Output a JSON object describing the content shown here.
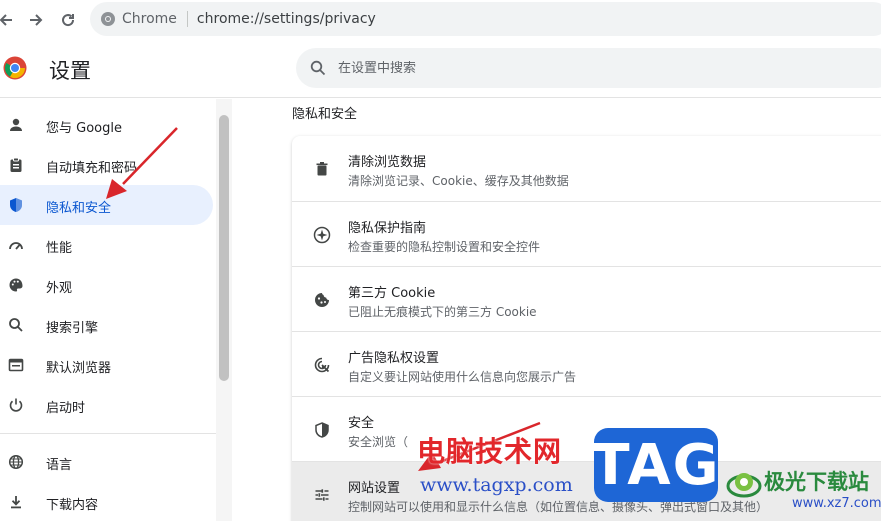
{
  "browser": {
    "site_name": "Chrome",
    "url": "chrome://settings/privacy"
  },
  "header": {
    "title": "设置",
    "search_placeholder": "在设置中搜索"
  },
  "sidebar": {
    "items": [
      {
        "label": "您与 Google",
        "icon": "person-icon"
      },
      {
        "label": "自动填充和密码",
        "icon": "clipboard-icon"
      },
      {
        "label": "隐私和安全",
        "icon": "shield-icon",
        "active": true
      },
      {
        "label": "性能",
        "icon": "speedometer-icon"
      },
      {
        "label": "外观",
        "icon": "palette-icon"
      },
      {
        "label": "搜索引擎",
        "icon": "search-icon"
      },
      {
        "label": "默认浏览器",
        "icon": "browser-window-icon"
      },
      {
        "label": "启动时",
        "icon": "power-icon"
      },
      {
        "label": "语言",
        "icon": "globe-icon"
      },
      {
        "label": "下载内容",
        "icon": "download-icon"
      }
    ]
  },
  "main": {
    "section_title": "隐私和安全",
    "rows": [
      {
        "title": "清除浏览数据",
        "subtitle": "清除浏览记录、Cookie、缓存及其他数据",
        "icon": "trash-icon"
      },
      {
        "title": "隐私保护指南",
        "subtitle": "检查重要的隐私控制设置和安全控件",
        "icon": "compass-icon"
      },
      {
        "title": "第三方 Cookie",
        "subtitle": "已阻止无痕模式下的第三方 Cookie",
        "icon": "cookie-icon"
      },
      {
        "title": "广告隐私权设置",
        "subtitle": "自定义要让网站使用什么信息向您展示广告",
        "icon": "ad-privacy-icon"
      },
      {
        "title": "安全",
        "subtitle": "安全浏览（",
        "icon": "shield-outline-icon"
      },
      {
        "title": "网站设置",
        "subtitle": "控制网站可以使用和显示什么信息（如位置信息、摄像头、弹出式窗口及其他）",
        "icon": "tune-icon"
      }
    ]
  },
  "watermark": {
    "cn_text": "电脑技术网",
    "url": "www.tagxp.com",
    "tag": "TAG",
    "site": "极光下载站",
    "site_url": "www.xz7.com"
  },
  "colors": {
    "accent": "#0b57d0",
    "active_bg": "#e8f0fe",
    "annotation_red": "#d9262b",
    "watermark_blue": "#1e66d6"
  }
}
